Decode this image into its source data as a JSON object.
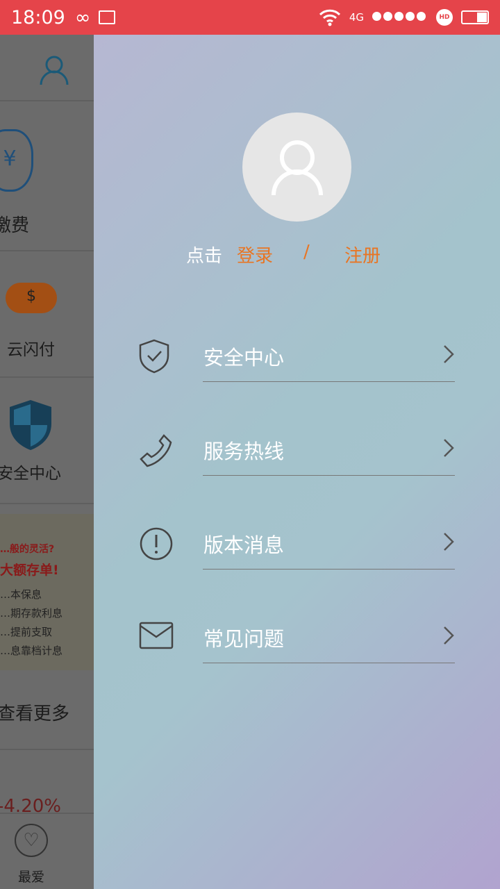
{
  "status": {
    "time": "18:09",
    "network": "4G",
    "signal_dots": 5
  },
  "background": {
    "items": [
      "缴费",
      "云闪付",
      "安全中心",
      "查看更多",
      "最爱"
    ],
    "ad": {
      "line1": "…般的灵活?",
      "line2": "大额存单!",
      "bullets": [
        "…本保息",
        "…期存款利息",
        "…提前支取",
        "…息靠档计息"
      ]
    },
    "rate": "-4.20%"
  },
  "drawer": {
    "login_prefix": "点击",
    "login": "登录",
    "sep": "/",
    "register": "注册",
    "menu": [
      {
        "label": "安全中心",
        "icon": "shield-check-icon"
      },
      {
        "label": "服务热线",
        "icon": "phone-icon"
      },
      {
        "label": "版本消息",
        "icon": "info-icon"
      },
      {
        "label": "常见问题",
        "icon": "mail-icon"
      }
    ]
  },
  "colors": {
    "status_bar": "#e5444a",
    "accent": "#e87523"
  }
}
